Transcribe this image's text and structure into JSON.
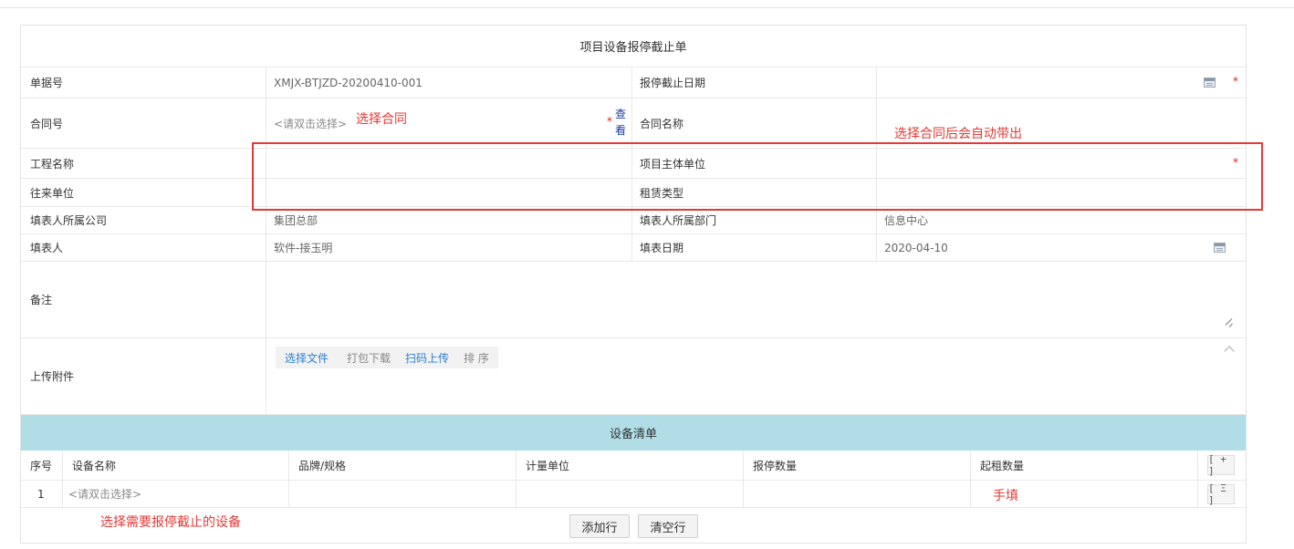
{
  "form": {
    "title": "项目设备报停截止单",
    "fields": {
      "doc_no_label": "单据号",
      "doc_no_value": "XMJX-BTJZD-20200410-001",
      "stop_date_label": "报停截止日期",
      "contract_no_label": "合同号",
      "contract_no_placeholder": "<请双击选择>",
      "view_link": "查看",
      "contract_name_label": "合同名称",
      "project_name_label": "工程名称",
      "main_unit_label": "项目主体单位",
      "partner_unit_label": "往来单位",
      "lease_type_label": "租赁类型",
      "company_label": "填表人所属公司",
      "company_value": "集团总部",
      "dept_label": "填表人所属部门",
      "dept_value": "信息中心",
      "filler_label": "填表人",
      "filler_value": "软件-接玉明",
      "fill_date_label": "填表日期",
      "fill_date_value": "2020-04-10",
      "remark_label": "备注",
      "attach_label": "上传附件"
    },
    "required_mark": "*",
    "attach_buttons": {
      "choose_file": "选择文件",
      "pack_download": "打包下载",
      "scan_upload": "扫码上传",
      "sort": "排 序"
    }
  },
  "equipment": {
    "title": "设备清单",
    "columns": [
      "序号",
      "设备名称",
      "品牌/规格",
      "计量单位",
      "报停数量",
      "起租数量"
    ],
    "add_col_btn": "[ + ]",
    "rows": [
      {
        "no": "1",
        "name_placeholder": "<请双击选择>",
        "row_btn": "[ Ξ ]"
      }
    ],
    "add_row_btn": "添加行",
    "clear_rows_btn": "清空行"
  },
  "annotations": {
    "select_contract": "选择合同",
    "auto_fill": "选择合同后会自动带出",
    "manual_fill": "手填",
    "select_equipment": "选择需要报停截止的设备"
  },
  "colors": {
    "annotation_red": "#e53935",
    "section_header_bg": "#b0dde6",
    "link_blue": "#2d7fd0"
  }
}
